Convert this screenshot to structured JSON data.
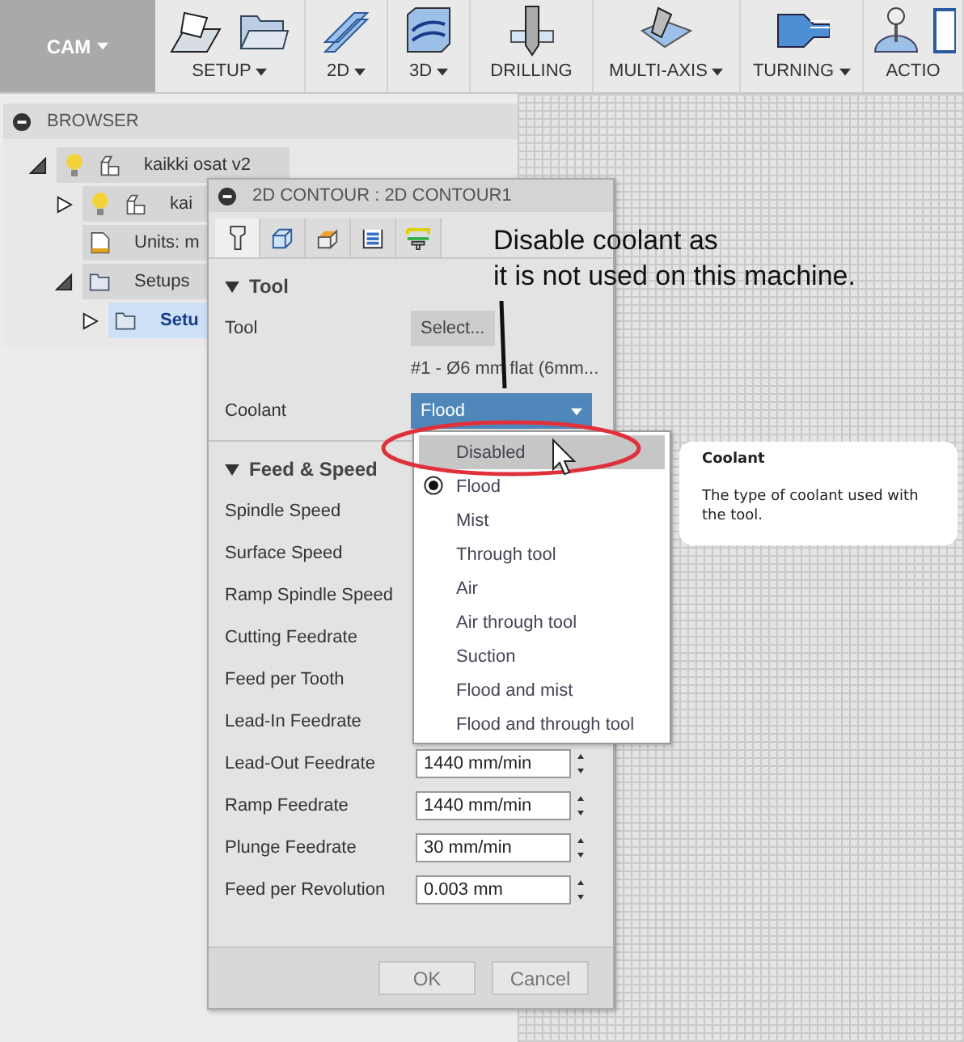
{
  "toolbar": {
    "workspace": {
      "label": "CAM",
      "has_menu": true
    },
    "groups": [
      {
        "label": "SETUP",
        "has_menu": true
      },
      {
        "label": "2D",
        "has_menu": true
      },
      {
        "label": "3D",
        "has_menu": true
      },
      {
        "label": "DRILLING",
        "has_menu": false
      },
      {
        "label": "MULTI-AXIS",
        "has_menu": true
      },
      {
        "label": "TURNING",
        "has_menu": true
      },
      {
        "label": "ACTIO",
        "has_menu": false
      }
    ]
  },
  "browser": {
    "title": "BROWSER",
    "tree": [
      {
        "label": "kaikki osat v2",
        "kind": "component",
        "visible": true,
        "expanded": true,
        "selected": false,
        "children": [
          {
            "label": "kai",
            "kind": "component",
            "visible": true,
            "expanded": false,
            "selected": false
          },
          {
            "label": "Units: m",
            "kind": "units",
            "selected": false
          },
          {
            "label": "Setups",
            "kind": "folder",
            "expanded": true,
            "selected": false,
            "children": [
              {
                "label": "Setu",
                "kind": "folder",
                "expanded": false,
                "selected": true
              }
            ]
          }
        ]
      }
    ]
  },
  "dialog": {
    "title": "2D CONTOUR : 2D CONTOUR1",
    "tabs": [
      {
        "selected": true
      },
      {
        "selected": false
      },
      {
        "selected": false
      },
      {
        "selected": false
      },
      {
        "selected": false
      }
    ],
    "sections": [
      {
        "title": "Tool",
        "expanded": true,
        "rows": [
          {
            "kind": "button",
            "label": "Tool",
            "value": "Select..."
          },
          {
            "kind": "note",
            "value": "#1 - Ø6 mm flat (6mm..."
          },
          {
            "kind": "select",
            "label": "Coolant",
            "value": "Flood"
          }
        ]
      },
      {
        "title": "Feed & Speed",
        "expanded": true,
        "rows": [
          {
            "kind": "number",
            "label": "Spindle Speed"
          },
          {
            "kind": "number",
            "label": "Surface Speed"
          },
          {
            "kind": "number",
            "label": "Ramp Spindle Speed"
          },
          {
            "kind": "number",
            "label": "Cutting Feedrate"
          },
          {
            "kind": "number",
            "label": "Feed per Tooth"
          },
          {
            "kind": "number",
            "label": "Lead-In Feedrate"
          },
          {
            "kind": "number",
            "label": "Lead-Out Feedrate",
            "value": "1440 mm/min"
          },
          {
            "kind": "number",
            "label": "Ramp Feedrate",
            "value": "1440 mm/min"
          },
          {
            "kind": "number",
            "label": "Plunge Feedrate",
            "value": "30 mm/min"
          },
          {
            "kind": "number",
            "label": "Feed per Revolution",
            "value": "0.003 mm"
          }
        ]
      }
    ],
    "buttons": [
      "OK",
      "Cancel"
    ]
  },
  "coolant_menu": {
    "options": [
      {
        "label": "Disabled",
        "selected": false,
        "highlighted": true
      },
      {
        "label": "Flood",
        "selected": true,
        "highlighted": false
      },
      {
        "label": "Mist",
        "selected": false,
        "highlighted": false
      },
      {
        "label": "Through tool",
        "selected": false,
        "highlighted": false
      },
      {
        "label": "Air",
        "selected": false,
        "highlighted": false
      },
      {
        "label": "Air through tool",
        "selected": false,
        "highlighted": false
      },
      {
        "label": "Suction",
        "selected": false,
        "highlighted": false
      },
      {
        "label": "Flood and mist",
        "selected": false,
        "highlighted": false
      },
      {
        "label": "Flood and through tool",
        "selected": false,
        "highlighted": false
      }
    ]
  },
  "tooltip": {
    "title": "Coolant",
    "text": "The type of coolant used with the tool."
  },
  "annotation": {
    "lines": [
      "Disable coolant as",
      "it is not used on this machine."
    ]
  }
}
